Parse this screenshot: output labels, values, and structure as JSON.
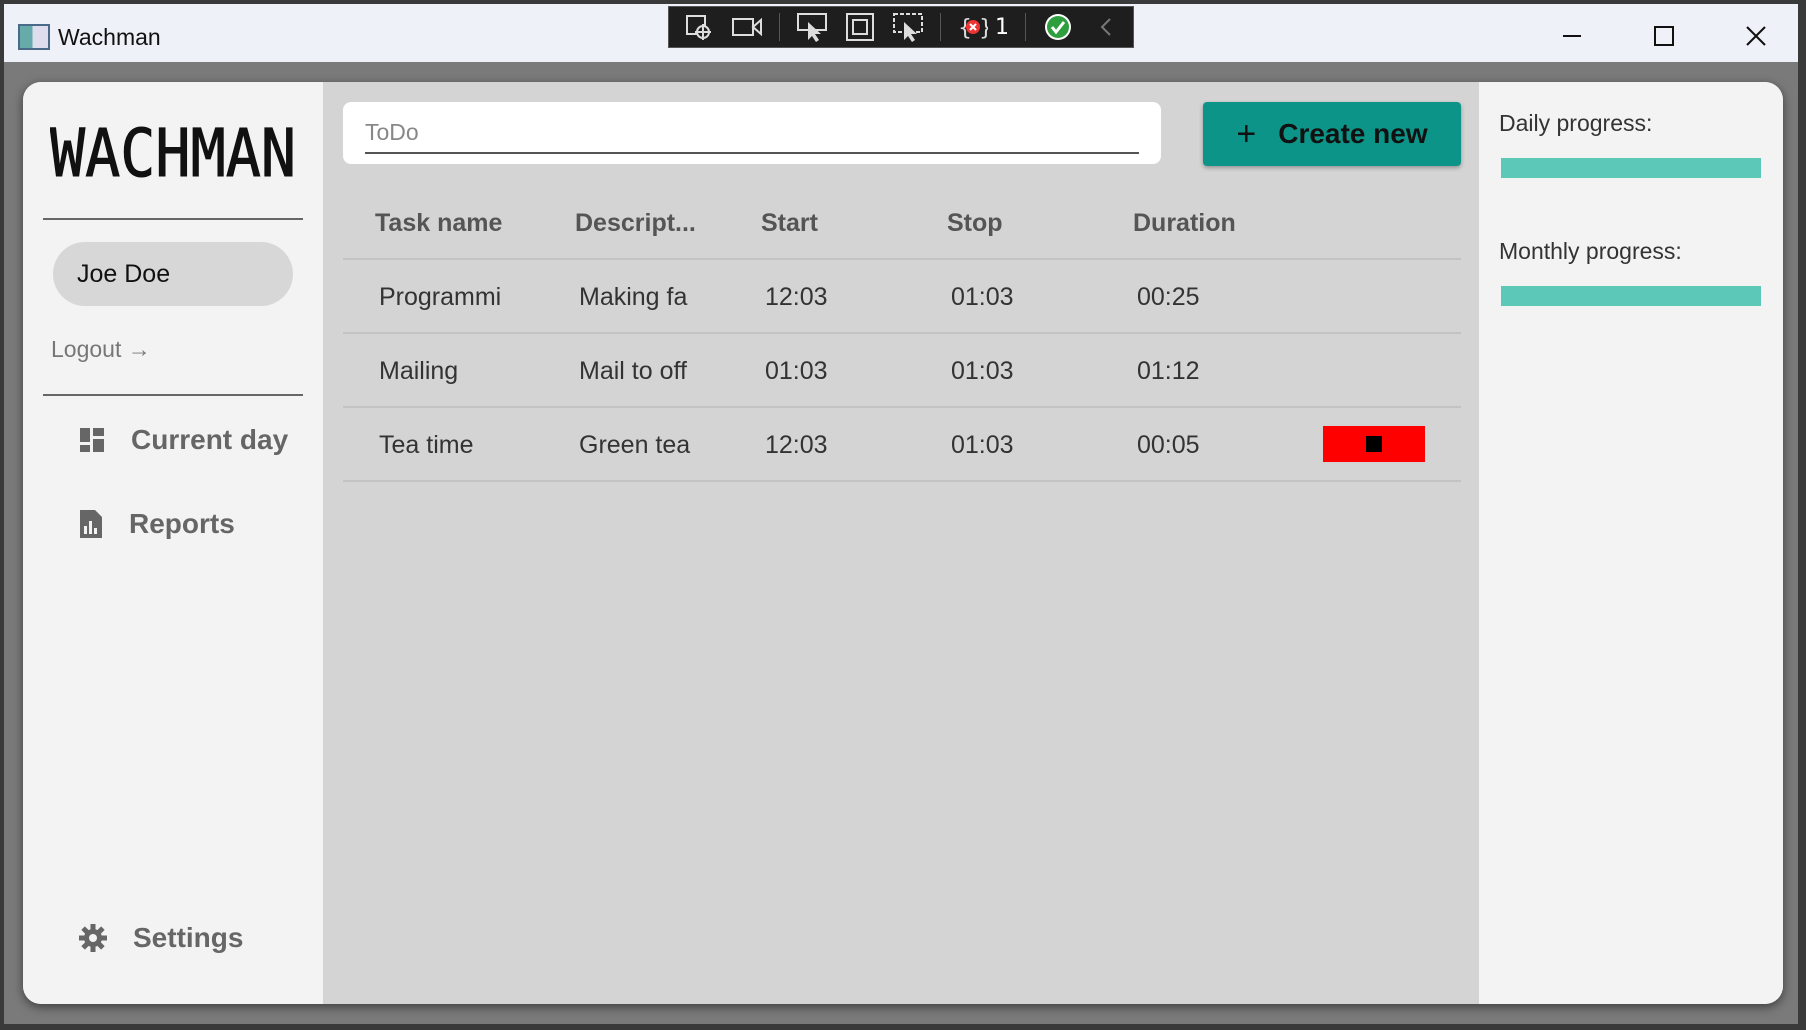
{
  "window": {
    "title": "Wachman",
    "icons": {
      "app": "app-icon",
      "minimize": "minimize-icon",
      "maximize": "maximize-icon",
      "close": "close-icon"
    }
  },
  "debug_toolbar": {
    "icons": [
      "select-element-icon",
      "record-icon",
      "pointer-select-icon",
      "layout-adorner-icon",
      "track-focus-icon",
      "binding-failures-icon",
      "hot-reload-ok-icon",
      "collapse-icon"
    ],
    "binding_failures_count": "1"
  },
  "sidebar": {
    "logo": "WACHMAN",
    "user_name": "Joe Doe",
    "logout_label": "Logout →",
    "nav": [
      {
        "label": "Current day",
        "icon": "dashboard-icon"
      },
      {
        "label": "Reports",
        "icon": "report-icon"
      }
    ],
    "settings": {
      "label": "Settings",
      "icon": "gear-icon"
    }
  },
  "main": {
    "task_input": {
      "placeholder": "ToDo",
      "value": ""
    },
    "create_button": {
      "label": "Create new",
      "icon": "plus-icon"
    },
    "table": {
      "headers": [
        "Task name",
        "Descript...",
        "Start",
        "Stop",
        "Duration"
      ],
      "rows": [
        {
          "name": "Programmi",
          "description": "Making fa",
          "start": "12:03",
          "stop": "01:03",
          "duration": "00:25",
          "running": false
        },
        {
          "name": "Mailing",
          "description": "Mail to off",
          "start": "01:03",
          "stop": "01:03",
          "duration": "01:12",
          "running": false
        },
        {
          "name": "Tea time",
          "description": "Green tea",
          "start": "12:03",
          "stop": "01:03",
          "duration": "00:05",
          "running": true,
          "stop_icon": "stop-icon"
        }
      ]
    }
  },
  "progress": {
    "daily_label": "Daily progress:",
    "daily_value": 1.0,
    "monthly_label": "Monthly progress:",
    "monthly_value": 1.0,
    "bar_color": "#5cc9b8"
  },
  "colors": {
    "accent": "#0d9488",
    "stop": "#ff0000"
  }
}
